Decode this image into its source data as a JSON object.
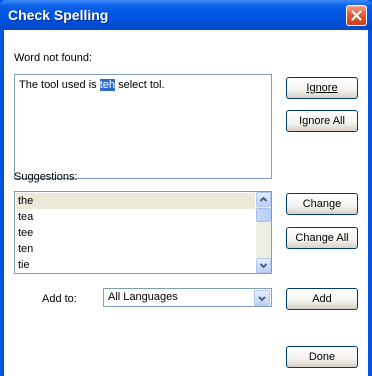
{
  "window": {
    "title": "Check Spelling",
    "close_icon": "close-icon"
  },
  "not_found": {
    "label": "Word not found:",
    "text_before": "The tool used is ",
    "misspelled": "teh",
    "text_after": " select tol."
  },
  "buttons": {
    "ignore": "Ignore",
    "ignore_all": "Ignore All",
    "change": "Change",
    "change_all": "Change All",
    "add": "Add",
    "done": "Done"
  },
  "suggestions": {
    "label": "Suggestions:",
    "items": [
      "the",
      "tea",
      "tee",
      "ten",
      "tie"
    ],
    "selected_index": 0
  },
  "add_to": {
    "label": "Add to:",
    "value": "All Languages"
  },
  "colors": {
    "title_bar": "#0054e3",
    "selection": "#316ac5",
    "close_button": "#e15b36"
  }
}
